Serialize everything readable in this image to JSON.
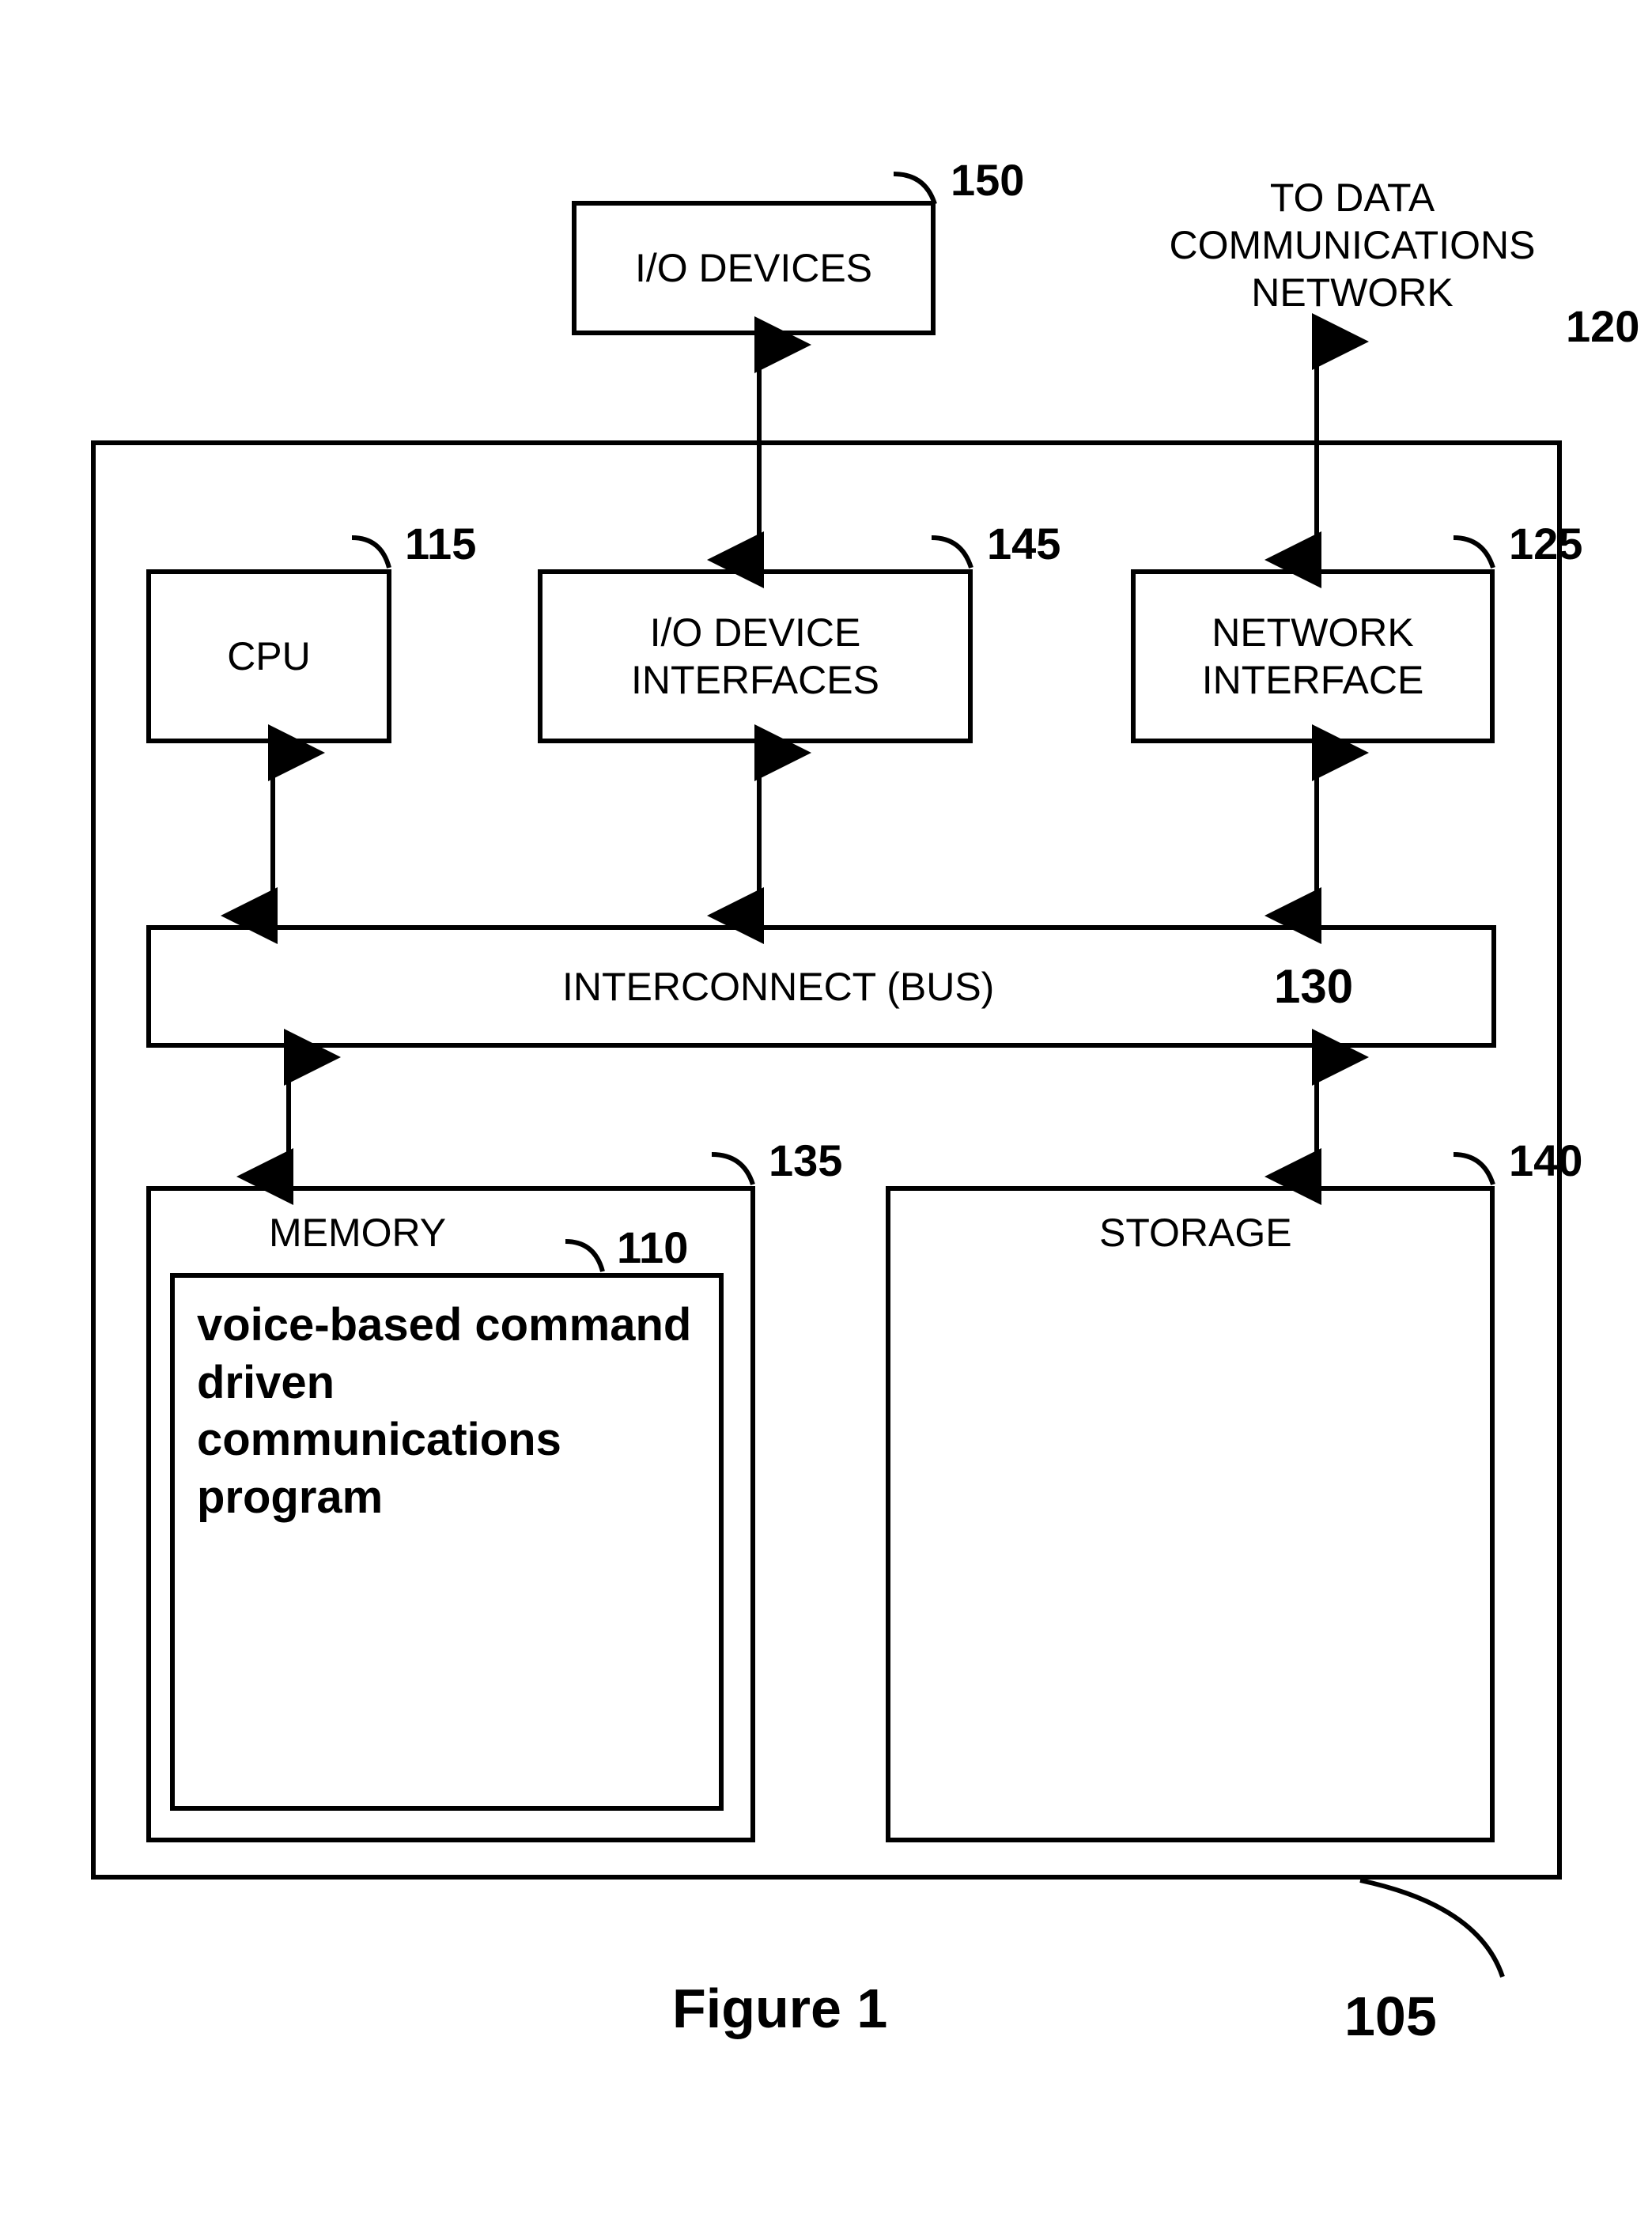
{
  "figure_caption": "Figure 1",
  "external": {
    "network_text": "TO DATA COMMUNICATIONS NETWORK",
    "network_ref": "120",
    "io_devices_label": "I/O DEVICES",
    "io_devices_ref": "150"
  },
  "system": {
    "ref": "105",
    "cpu": {
      "label": "CPU",
      "ref": "115"
    },
    "io_iface": {
      "label": "I/O DEVICE INTERFACES",
      "ref": "145"
    },
    "net_iface": {
      "label": "NETWORK INTERFACE",
      "ref": "125"
    },
    "bus": {
      "label": "INTERCONNECT (BUS)",
      "ref": "130"
    },
    "memory": {
      "label": "MEMORY",
      "ref": "135",
      "program": {
        "label": "voice-based command driven communications program",
        "ref": "110"
      }
    },
    "storage": {
      "label": "STORAGE",
      "ref": "140"
    }
  }
}
